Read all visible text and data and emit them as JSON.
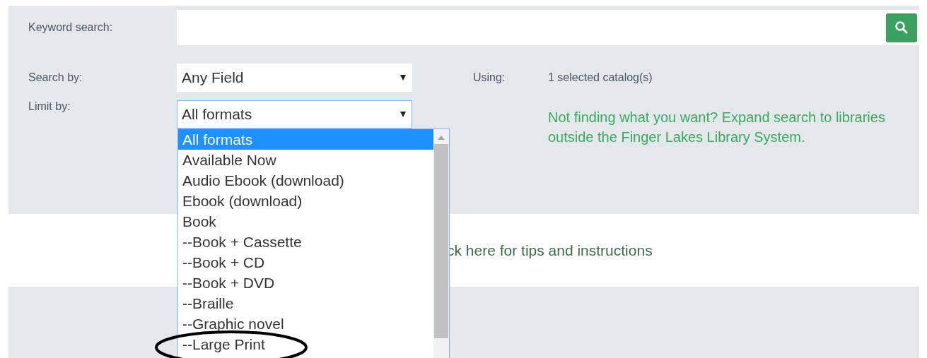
{
  "keyword_search": {
    "label": "Keyword search:"
  },
  "search_by": {
    "label": "Search by:",
    "value": "Any Field"
  },
  "using": {
    "label": "Using:",
    "value": "1 selected catalog(s)"
  },
  "limit_by": {
    "label": "Limit by:",
    "value": "All formats",
    "open": true,
    "options": [
      {
        "label": "All formats",
        "selected": true
      },
      {
        "label": "Available Now",
        "selected": false
      },
      {
        "label": "Audio Ebook (download)",
        "selected": false
      },
      {
        "label": "Ebook (download)",
        "selected": false
      },
      {
        "label": "Book",
        "selected": false
      },
      {
        "label": "--Book + Cassette",
        "selected": false
      },
      {
        "label": "--Book + CD",
        "selected": false
      },
      {
        "label": "--Book + DVD",
        "selected": false
      },
      {
        "label": "--Braille",
        "selected": false
      },
      {
        "label": "--Graphic novel",
        "selected": false
      },
      {
        "label": "--Large Print",
        "selected": false
      }
    ]
  },
  "expand_link": "Not finding what you want? Expand search to libraries outside the Finger Lakes Library System.",
  "tips_link": "ck here for tips and instructions"
}
